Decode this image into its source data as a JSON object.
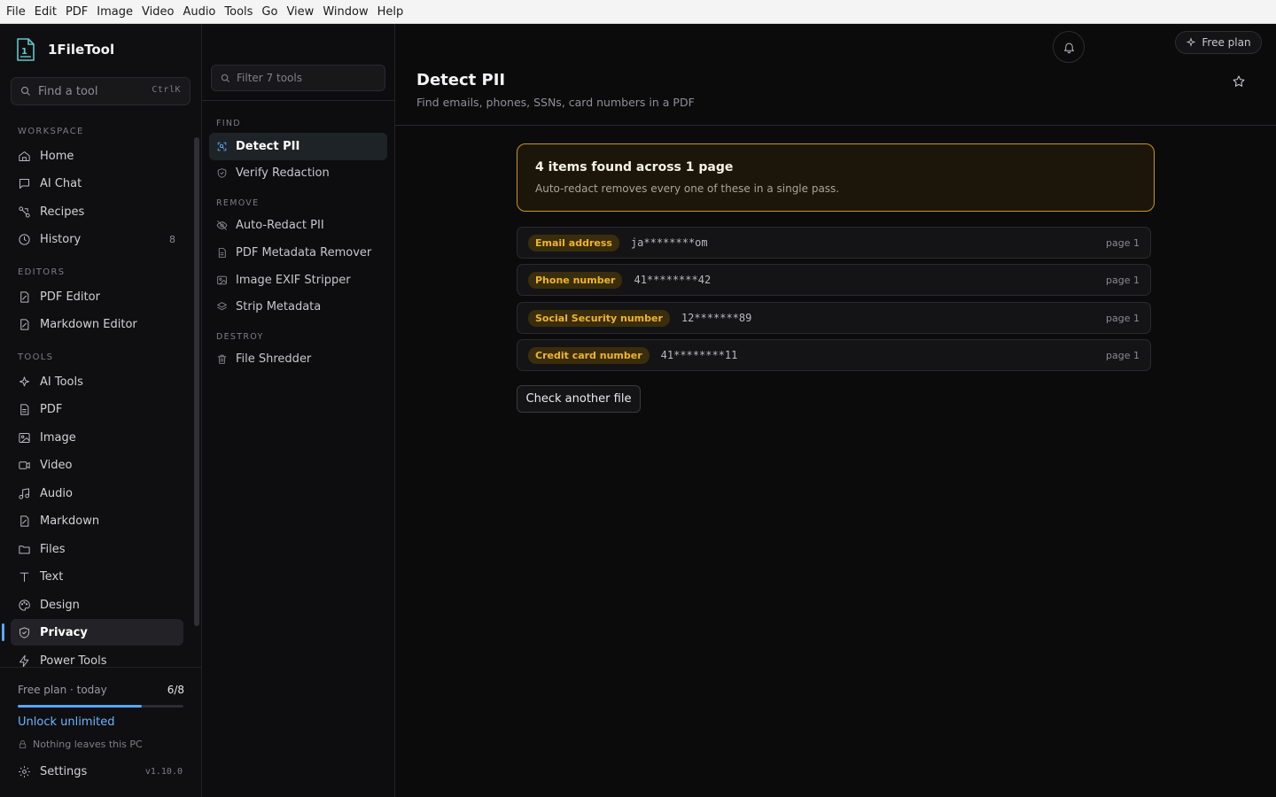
{
  "menubar": [
    "File",
    "Edit",
    "PDF",
    "Image",
    "Video",
    "Audio",
    "Tools",
    "Go",
    "View",
    "Window",
    "Help"
  ],
  "app": {
    "name": "1FileTool"
  },
  "search": {
    "placeholder": "Find a tool",
    "shortcut": "CtrlK"
  },
  "sidebar": {
    "workspace_label": "WORKSPACE",
    "workspace": [
      {
        "label": "Home",
        "icon": "home-icon"
      },
      {
        "label": "AI Chat",
        "icon": "chat-icon"
      },
      {
        "label": "Recipes",
        "icon": "recipes-icon"
      },
      {
        "label": "History",
        "icon": "history-icon",
        "count": "8"
      }
    ],
    "editors_label": "EDITORS",
    "editors": [
      {
        "label": "PDF Editor",
        "icon": "pdf-editor-icon"
      },
      {
        "label": "Markdown Editor",
        "icon": "markdown-editor-icon"
      }
    ],
    "tools_label": "TOOLS",
    "tools": [
      {
        "label": "AI Tools",
        "icon": "sparkle-icon"
      },
      {
        "label": "PDF",
        "icon": "file-icon"
      },
      {
        "label": "Image",
        "icon": "image-icon"
      },
      {
        "label": "Video",
        "icon": "video-icon"
      },
      {
        "label": "Audio",
        "icon": "music-icon"
      },
      {
        "label": "Markdown",
        "icon": "markdown-icon"
      },
      {
        "label": "Files",
        "icon": "folder-icon"
      },
      {
        "label": "Text",
        "icon": "text-icon"
      },
      {
        "label": "Design",
        "icon": "palette-icon"
      },
      {
        "label": "Privacy",
        "icon": "shield-icon",
        "active": true
      },
      {
        "label": "Power Tools",
        "icon": "bolt-icon"
      }
    ]
  },
  "plan": {
    "label": "Free plan · today",
    "count": "6/8",
    "used": 6,
    "limit": 8,
    "unlock": "Unlock unlimited",
    "local_note": "Nothing leaves this PC",
    "settings": "Settings",
    "version": "v1.10.0"
  },
  "tools_panel": {
    "filter_placeholder": "Filter 7 tools",
    "groups": [
      {
        "label": "FIND",
        "items": [
          {
            "label": "Detect PII",
            "icon": "scan-icon",
            "active": true
          },
          {
            "label": "Verify Redaction",
            "icon": "shield-check-icon"
          }
        ]
      },
      {
        "label": "REMOVE",
        "items": [
          {
            "label": "Auto-Redact PII",
            "icon": "eye-off-icon"
          },
          {
            "label": "PDF Metadata Remover",
            "icon": "file-text-icon"
          },
          {
            "label": "Image EXIF Stripper",
            "icon": "image-icon"
          },
          {
            "label": "Strip Metadata",
            "icon": "layers-icon"
          }
        ]
      },
      {
        "label": "DESTROY",
        "items": [
          {
            "label": "File Shredder",
            "icon": "trash-icon"
          }
        ]
      }
    ]
  },
  "header": {
    "title": "Detect PII",
    "subtitle": "Find emails, phones, SSNs, card numbers in a PDF",
    "free_plan": "Free plan"
  },
  "summary": {
    "title": "4 items found across 1 page",
    "text": "Auto-redact removes every one of these in a single pass."
  },
  "findings": [
    {
      "type": "Email address",
      "value": "ja********om",
      "page": "page 1"
    },
    {
      "type": "Phone number",
      "value": "41********42",
      "page": "page 1"
    },
    {
      "type": "Social Security number",
      "value": "12*******89",
      "page": "page 1"
    },
    {
      "type": "Credit card number",
      "value": "41********11",
      "page": "page 1"
    }
  ],
  "actions": {
    "check_another": "Check another file"
  },
  "colors": {
    "accent": "#59a8ff",
    "warning": "#f0b429"
  }
}
